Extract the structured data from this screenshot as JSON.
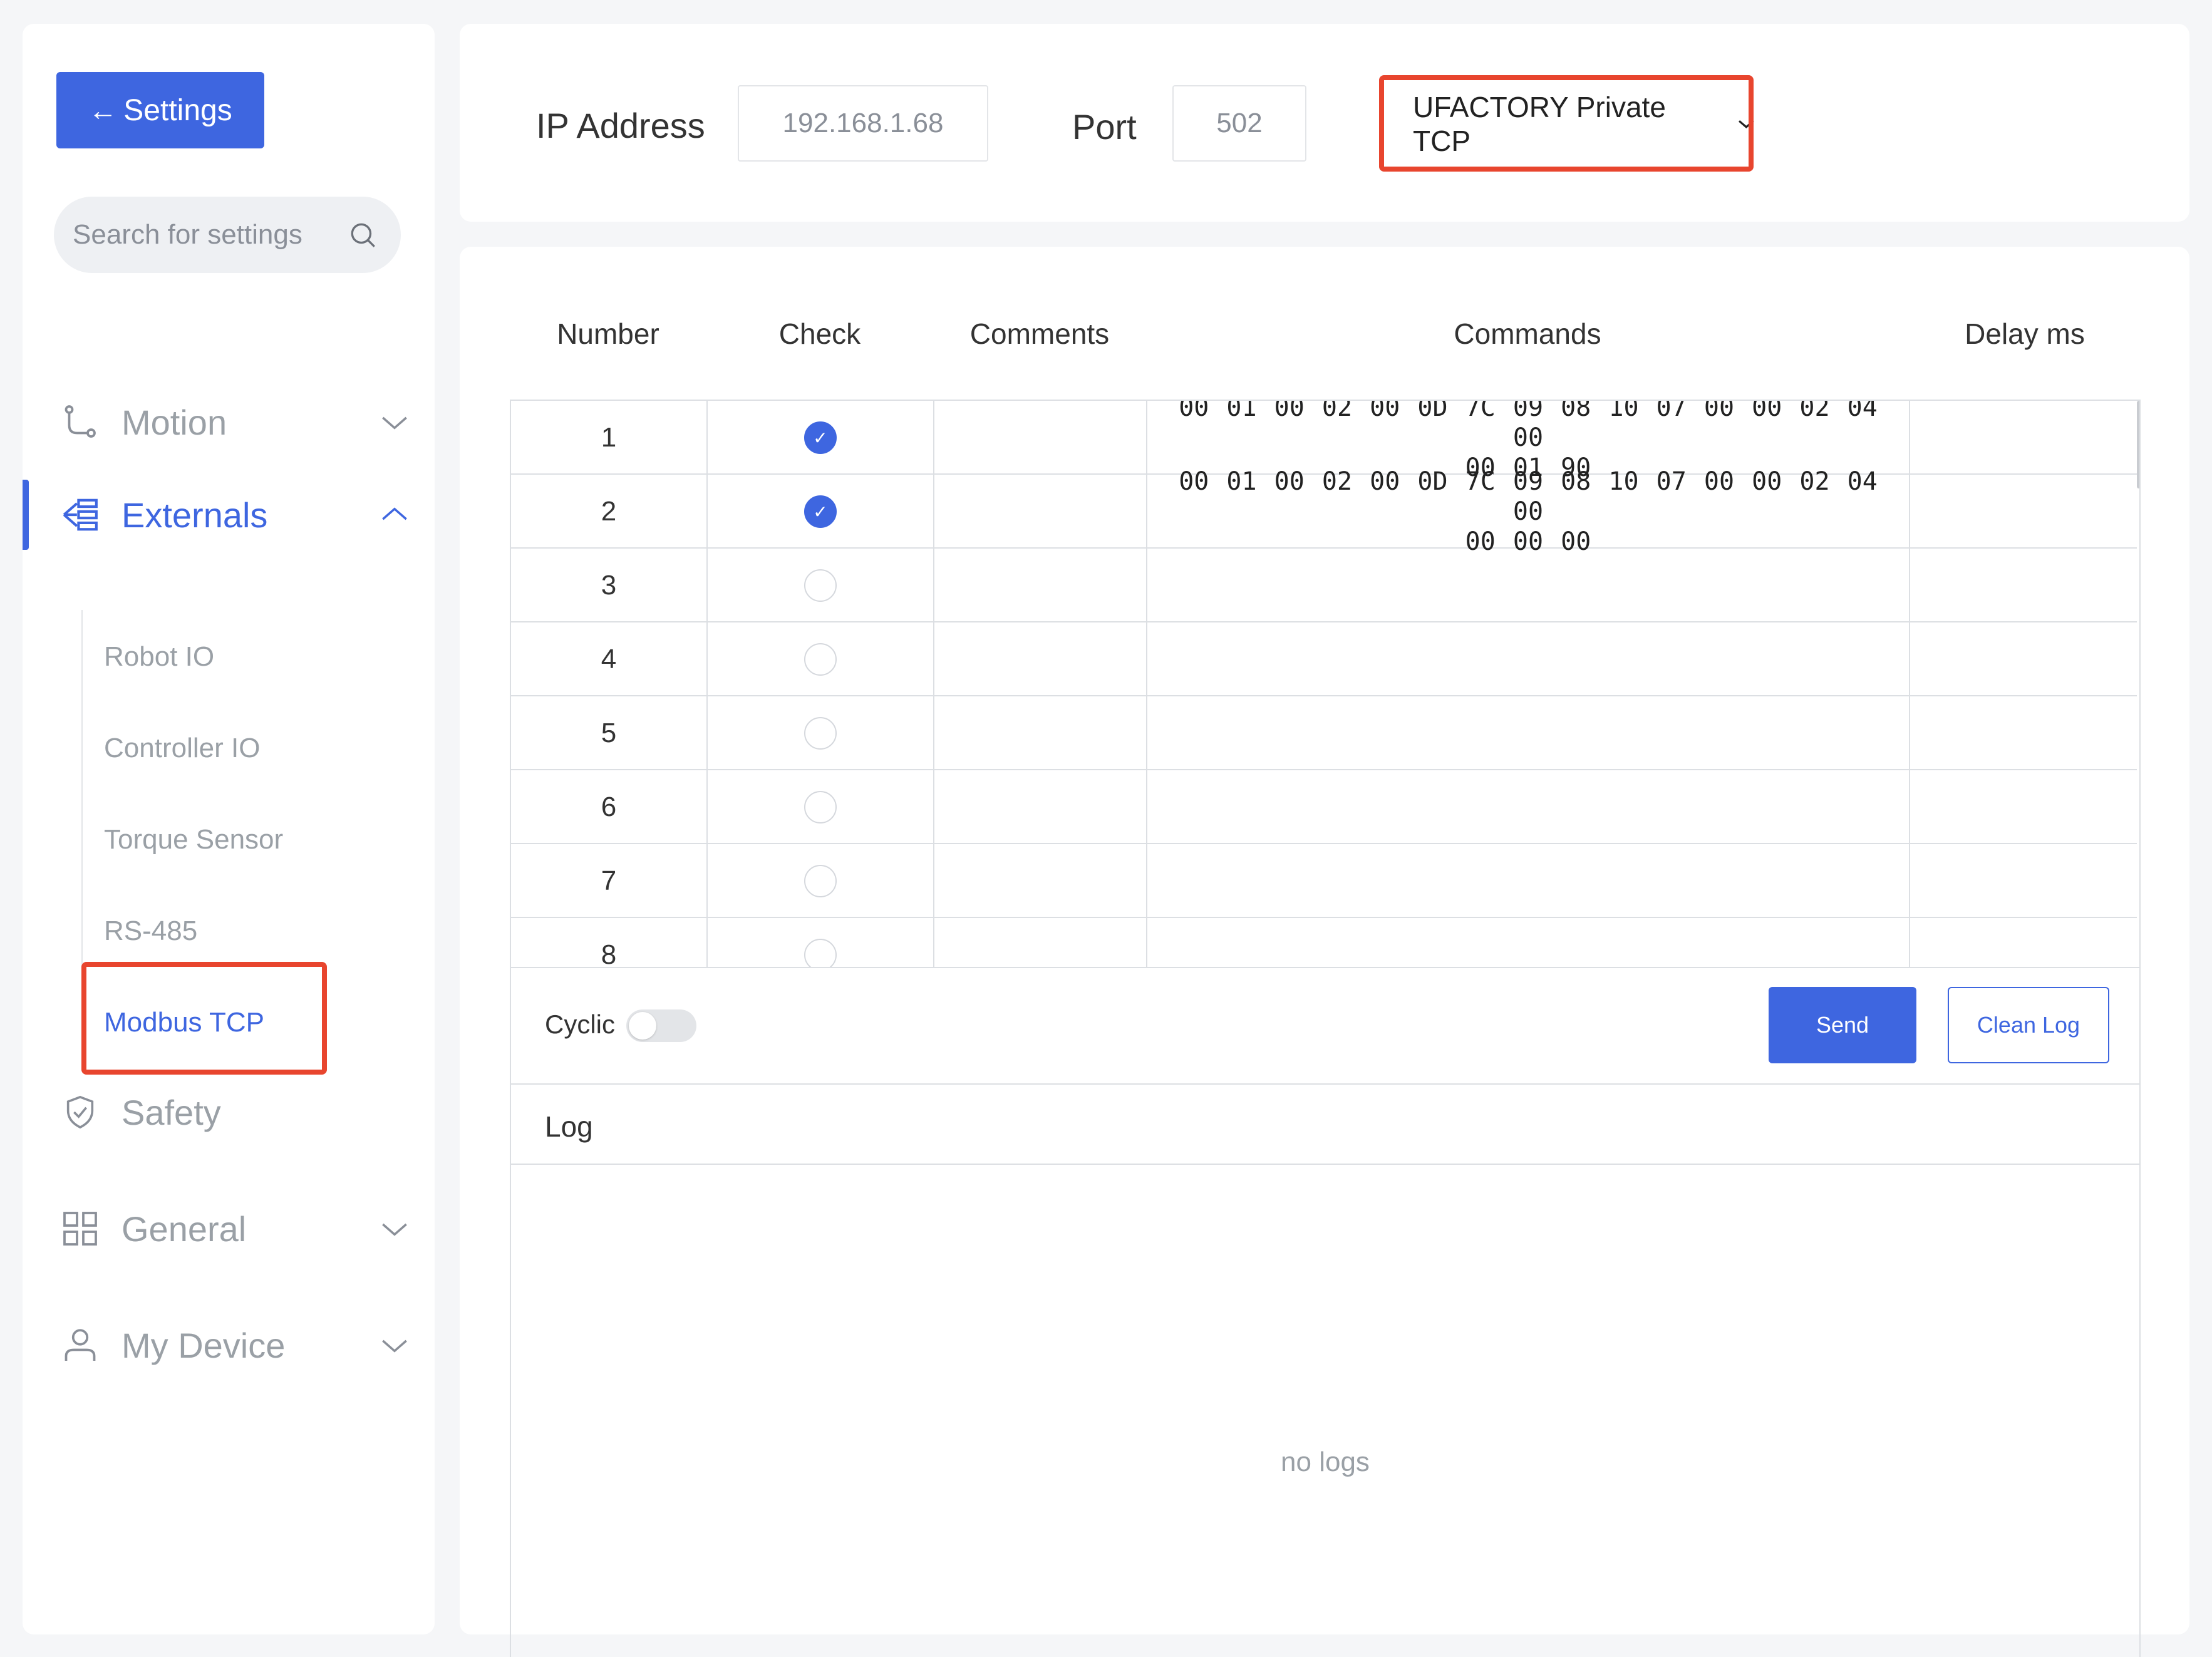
{
  "sidebar": {
    "back_label": "Settings",
    "search_placeholder": "Search for settings",
    "nav": [
      {
        "label": "Motion",
        "icon": "route-icon",
        "expanded": false
      },
      {
        "label": "Externals",
        "icon": "externals-icon",
        "expanded": true,
        "active": true
      },
      {
        "label": "Safety",
        "icon": "shield-icon"
      },
      {
        "label": "General",
        "icon": "grid-icon",
        "expanded": false
      },
      {
        "label": "My Device",
        "icon": "user-icon",
        "expanded": false
      }
    ],
    "externals_sub": [
      "Robot IO",
      "Controller IO",
      "Torque Sensor",
      "RS-485",
      "Modbus TCP"
    ],
    "active_sub": "Modbus TCP"
  },
  "connection": {
    "ip_label": "IP Address",
    "ip_value": "192.168.1.68",
    "port_label": "Port",
    "port_value": "502",
    "protocol": "UFACTORY Private TCP"
  },
  "table": {
    "headers": [
      "Number",
      "Check",
      "Comments",
      "Commands",
      "Delay ms"
    ],
    "rows": [
      {
        "number": "1",
        "checked": true,
        "comment": "",
        "command_line1": "00 01 00 02 00 0D 7C 09 08 10 07 00 00 02 04 00",
        "command_line2": "00 01 90",
        "delay": ""
      },
      {
        "number": "2",
        "checked": true,
        "comment": "",
        "command_line1": "00 01 00 02 00 0D 7C 09 08 10 07 00 00 02 04 00",
        "command_line2": "00 00 00",
        "delay": ""
      },
      {
        "number": "3",
        "checked": false,
        "comment": "",
        "command_line1": "",
        "command_line2": "",
        "delay": ""
      },
      {
        "number": "4",
        "checked": false,
        "comment": "",
        "command_line1": "",
        "command_line2": "",
        "delay": ""
      },
      {
        "number": "5",
        "checked": false,
        "comment": "",
        "command_line1": "",
        "command_line2": "",
        "delay": ""
      },
      {
        "number": "6",
        "checked": false,
        "comment": "",
        "command_line1": "",
        "command_line2": "",
        "delay": ""
      },
      {
        "number": "7",
        "checked": false,
        "comment": "",
        "command_line1": "",
        "command_line2": "",
        "delay": ""
      },
      {
        "number": "8",
        "checked": false,
        "comment": "",
        "command_line1": "",
        "command_line2": "",
        "delay": ""
      }
    ]
  },
  "actions": {
    "cyclic_label": "Cyclic",
    "cyclic_on": false,
    "send_label": "Send",
    "clean_label": "Clean Log"
  },
  "log": {
    "title": "Log",
    "empty_text": "no logs"
  },
  "colors": {
    "accent": "#3e66e0",
    "highlight": "#e8452e"
  }
}
